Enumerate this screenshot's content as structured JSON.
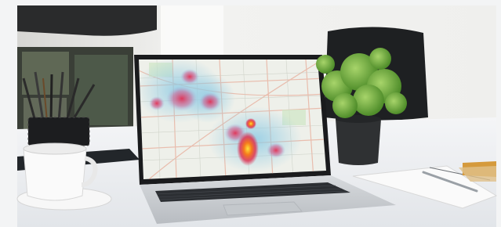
{
  "image": {
    "kind": "photo",
    "subject": "laptop-on-desk",
    "screen_content": "city-map-heatmap",
    "colors": {
      "frame": "#f3f4f5",
      "wall": "#f1f1ef",
      "desk": "#eef0f2",
      "laptop_body": "#c9ccd0",
      "heat_low": "#8fd0e6",
      "heat_high": "#d9163a",
      "heat_hot": "#ffd21a",
      "plant": "#5f9f2e",
      "pot": "#2f3133"
    }
  }
}
